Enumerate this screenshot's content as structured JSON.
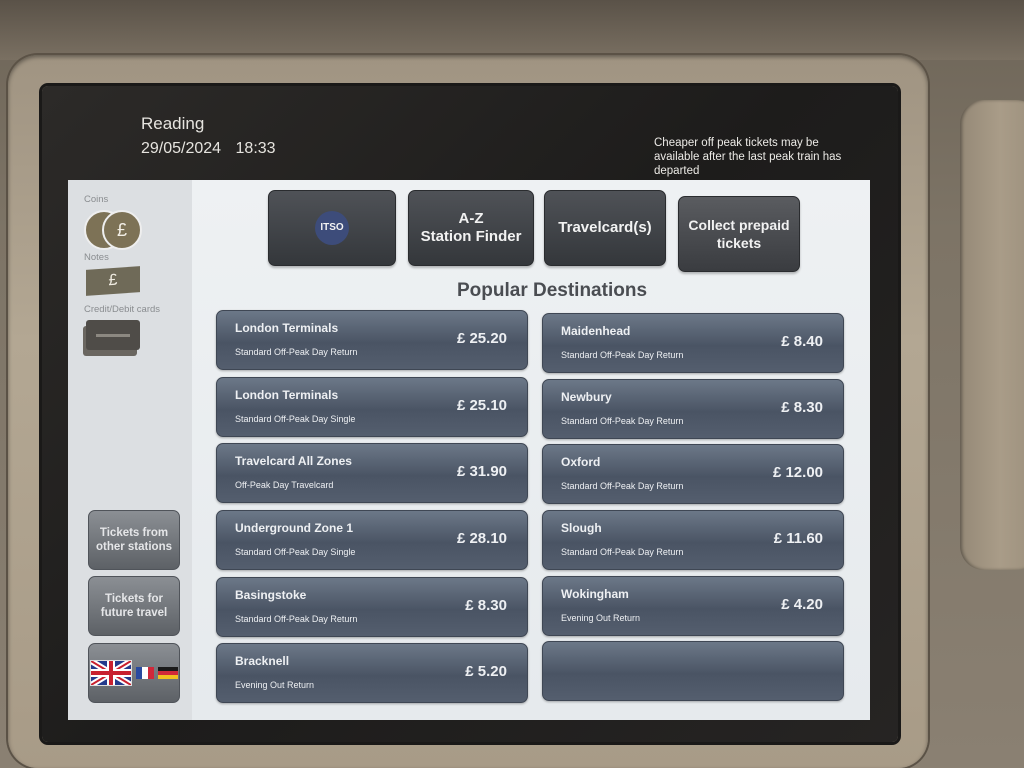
{
  "header": {
    "station": "Reading",
    "date": "29/05/2024",
    "time": "18:33",
    "notice": "Cheaper off peak tickets may be available after the last peak train has departed"
  },
  "payment_methods": {
    "coins_label": "Coins",
    "coins_symbol": "£",
    "notes_label": "Notes",
    "notes_symbol": "£",
    "cards_label": "Credit/Debit cards"
  },
  "side_buttons": {
    "other_stations": "Tickets from other stations",
    "future_travel": "Tickets for future travel",
    "language": "Language"
  },
  "flag_colors": {
    "fr": [
      "#2a4aa0",
      "#ffffff",
      "#d0283a"
    ],
    "de": [
      "#1a1a1a",
      "#d0283a",
      "#f0c020"
    ]
  },
  "top_buttons": [
    {
      "label": "ITSO"
    },
    {
      "label_line1": "A-Z",
      "label_line2": "Station Finder"
    },
    {
      "label": "Travelcard(s)"
    },
    {
      "label": "Collect prepaid tickets"
    }
  ],
  "popular": {
    "title": "Popular Destinations",
    "left": [
      {
        "name": "London Terminals",
        "type": "Standard Off-Peak Day Return",
        "price": "£ 25.20"
      },
      {
        "name": "London Terminals",
        "type": "Standard Off-Peak Day Single",
        "price": "£ 25.10"
      },
      {
        "name": "Travelcard All Zones",
        "type": "Off-Peak Day Travelcard",
        "price": "£ 31.90"
      },
      {
        "name": "Underground Zone 1",
        "type": "Standard Off-Peak Day Single",
        "price": "£ 28.10"
      },
      {
        "name": "Basingstoke",
        "type": "Standard Off-Peak Day Return",
        "price": "£ 8.30"
      },
      {
        "name": "Bracknell",
        "type": "Evening Out Return",
        "price": "£ 5.20"
      }
    ],
    "right": [
      {
        "name": "Maidenhead",
        "type": "Standard Off-Peak Day Return",
        "price": "£ 8.40"
      },
      {
        "name": "Newbury",
        "type": "Standard Off-Peak Day Return",
        "price": "£ 8.30"
      },
      {
        "name": "Oxford",
        "type": "Standard Off-Peak Day Return",
        "price": "£ 12.00"
      },
      {
        "name": "Slough",
        "type": "Standard Off-Peak Day Return",
        "price": "£ 11.60"
      },
      {
        "name": "Wokingham",
        "type": "Evening Out Return",
        "price": "£ 4.20"
      },
      {
        "name": "",
        "type": "",
        "price": ""
      }
    ]
  }
}
